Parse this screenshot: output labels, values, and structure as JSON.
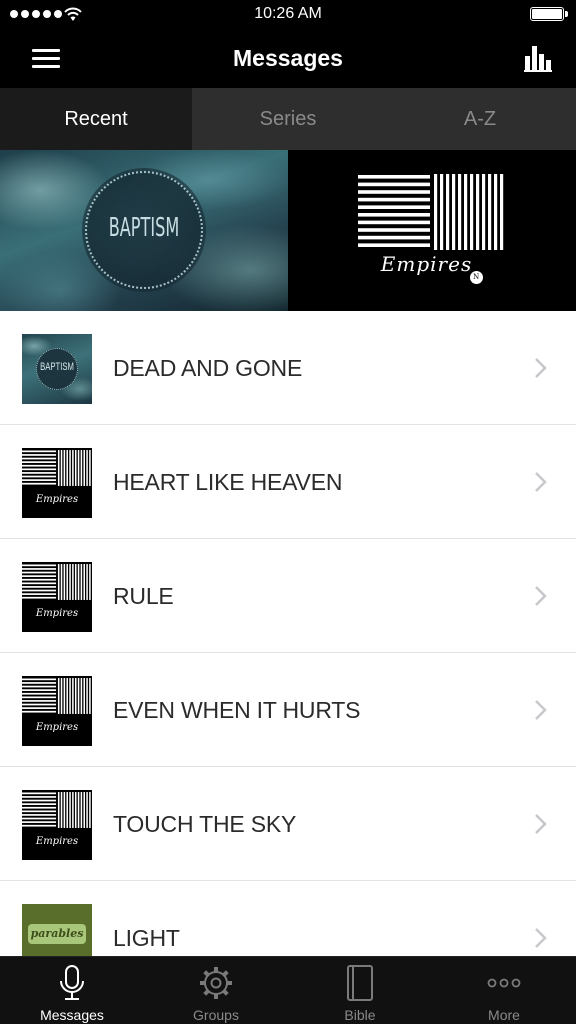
{
  "status_bar": {
    "time": "10:26 AM",
    "signal_icon": "signal-dots-icon",
    "wifi_icon": "wifi-icon",
    "battery_icon": "battery-icon",
    "battery_level": 1.0
  },
  "nav": {
    "title": "Messages",
    "menu_icon": "hamburger-menu-icon",
    "stats_icon": "bar-chart-icon"
  },
  "tabs": [
    {
      "label": "Recent",
      "active": true
    },
    {
      "label": "Series",
      "active": false
    },
    {
      "label": "A-Z",
      "active": false
    }
  ],
  "featured": [
    {
      "series": "BAPTISM",
      "style": "teal-clouds"
    },
    {
      "series": "Empires",
      "style": "black-stripes"
    }
  ],
  "messages": [
    {
      "title": "DEAD AND GONE",
      "thumbnail": "baptism",
      "thumb_text": "BAPTISM"
    },
    {
      "title": "HEART LIKE HEAVEN",
      "thumbnail": "empires",
      "thumb_text": "Empires"
    },
    {
      "title": "RULE",
      "thumbnail": "empires",
      "thumb_text": "Empires"
    },
    {
      "title": "EVEN WHEN IT HURTS",
      "thumbnail": "empires",
      "thumb_text": "Empires"
    },
    {
      "title": "TOUCH THE SKY",
      "thumbnail": "empires",
      "thumb_text": "Empires"
    },
    {
      "title": "LIGHT",
      "thumbnail": "parables",
      "thumb_text": "parables"
    }
  ],
  "tab_bar": [
    {
      "label": "Messages",
      "icon": "microphone-icon",
      "active": true
    },
    {
      "label": "Groups",
      "icon": "gear-icon",
      "active": false
    },
    {
      "label": "Bible",
      "icon": "book-icon",
      "active": false
    },
    {
      "label": "More",
      "icon": "ellipsis-icon",
      "active": false
    }
  ],
  "colors": {
    "bar_background": "#000000",
    "tab_active": "#1b1b1b",
    "tab_inactive": "#2e2e2e",
    "list_text": "#2b2b2b",
    "chevron": "#c7c7cc"
  }
}
